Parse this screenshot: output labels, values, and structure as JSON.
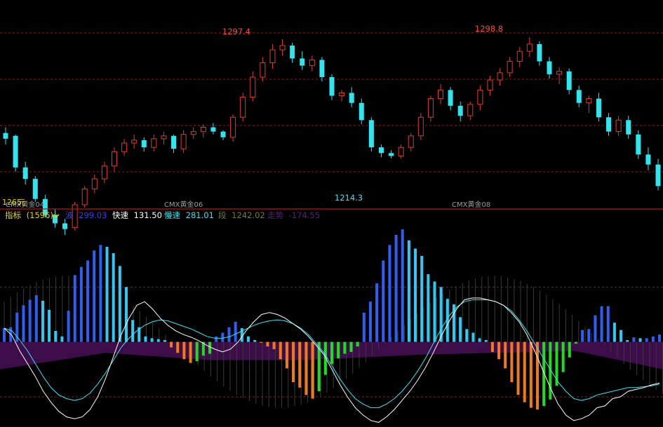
{
  "colors": {
    "background": "#000000",
    "grid": "#8b1a1a",
    "up": "#e23a2a",
    "down": "#2ee6f0",
    "high_label": "#ff4a3a",
    "low_label": "#35e5f2",
    "hist_blue": "#2f5ef5",
    "hist_cyan": "#30c9f5",
    "hist_orange": "#f07a1a",
    "hist_green": "#1fdc1f",
    "trend_fill": "#3d0d4a",
    "fast_line": "#ffffff",
    "slow_line": "#35e5f2",
    "contract_label": "#9a9a9a",
    "indicator_label": "#e8d400",
    "bo_value": "#3b3bff",
    "kuai_value": "#ffffff",
    "man_value": "#35e5f2",
    "duan_value": "#7a7a30",
    "zoushi_value": "#5a1e78"
  },
  "price_panel": {
    "high_label_1": "1297.4",
    "high_label_2": "1298.8",
    "low_label": "1214.3",
    "left_edge_label": "1265",
    "left_edge_unit": "元",
    "contract_labels": [
      "CMX黄金04",
      "CMX黄金06",
      "CMX黄金08"
    ]
  },
  "indicator_header": {
    "name": "指标",
    "param": "(1596)",
    "dropdown_icon": "chevron-down-icon",
    "items": [
      {
        "label": "波",
        "value": "299.03"
      },
      {
        "label": "快速",
        "value": "131.50"
      },
      {
        "label": "慢速",
        "value": "281.01"
      },
      {
        "label": "段",
        "value": "1242.02"
      },
      {
        "label": "走势",
        "value": "-174.55"
      }
    ]
  },
  "chart_data": [
    {
      "type": "candlestick",
      "title": "",
      "ylim": [
        1180,
        1315
      ],
      "candles": [
        [
          1232,
          1236,
          1224,
          1228
        ],
        [
          1230,
          1231,
          1205,
          1208
        ],
        [
          1208,
          1212,
          1196,
          1200
        ],
        [
          1200,
          1202,
          1184,
          1186
        ],
        [
          1186,
          1189,
          1173,
          1175
        ],
        [
          1175,
          1179,
          1166,
          1169
        ],
        [
          1169,
          1172,
          1161,
          1165
        ],
        [
          1166,
          1184,
          1164,
          1182
        ],
        [
          1182,
          1195,
          1180,
          1193
        ],
        [
          1193,
          1203,
          1190,
          1200
        ],
        [
          1200,
          1212,
          1197,
          1209
        ],
        [
          1209,
          1222,
          1205,
          1219
        ],
        [
          1219,
          1228,
          1216,
          1225
        ],
        [
          1225,
          1231,
          1221,
          1227
        ],
        [
          1227,
          1229,
          1219,
          1222
        ],
        [
          1222,
          1231,
          1219,
          1228
        ],
        [
          1228,
          1233,
          1224,
          1230
        ],
        [
          1230,
          1231,
          1218,
          1221
        ],
        [
          1221,
          1234,
          1218,
          1231
        ],
        [
          1231,
          1236,
          1228,
          1233
        ],
        [
          1233,
          1238,
          1229,
          1236
        ],
        [
          1236,
          1239,
          1231,
          1233
        ],
        [
          1233,
          1234,
          1227,
          1229
        ],
        [
          1229,
          1245,
          1226,
          1243
        ],
        [
          1243,
          1260,
          1240,
          1257
        ],
        [
          1257,
          1275,
          1254,
          1271
        ],
        [
          1271,
          1285,
          1268,
          1281
        ],
        [
          1281,
          1294,
          1277,
          1290
        ],
        [
          1290,
          1297.4,
          1286,
          1293
        ],
        [
          1293,
          1295,
          1281,
          1284
        ],
        [
          1284,
          1289,
          1276,
          1279
        ],
        [
          1279,
          1286,
          1275,
          1283
        ],
        [
          1283,
          1285,
          1268,
          1271
        ],
        [
          1271,
          1273,
          1255,
          1258
        ],
        [
          1258,
          1262,
          1254,
          1260
        ],
        [
          1260,
          1264,
          1250,
          1253
        ],
        [
          1253,
          1256,
          1238,
          1241
        ],
        [
          1241,
          1243,
          1219,
          1222
        ],
        [
          1222,
          1224,
          1215,
          1218
        ],
        [
          1218,
          1220,
          1214.3,
          1216
        ],
        [
          1216,
          1224,
          1214,
          1222
        ],
        [
          1222,
          1232,
          1219,
          1230
        ],
        [
          1230,
          1246,
          1227,
          1243
        ],
        [
          1243,
          1258,
          1240,
          1256
        ],
        [
          1256,
          1266,
          1252,
          1262
        ],
        [
          1262,
          1264,
          1248,
          1251
        ],
        [
          1251,
          1254,
          1240,
          1244
        ],
        [
          1244,
          1254,
          1241,
          1252
        ],
        [
          1252,
          1265,
          1248,
          1262
        ],
        [
          1262,
          1272,
          1258,
          1269
        ],
        [
          1269,
          1277,
          1265,
          1274
        ],
        [
          1274,
          1285,
          1271,
          1282
        ],
        [
          1282,
          1292,
          1278,
          1289
        ],
        [
          1289,
          1298.8,
          1285,
          1294
        ],
        [
          1294,
          1296,
          1279,
          1282
        ],
        [
          1282,
          1285,
          1270,
          1273
        ],
        [
          1273,
          1278,
          1266,
          1275
        ],
        [
          1275,
          1277,
          1259,
          1262
        ],
        [
          1262,
          1265,
          1250,
          1253
        ],
        [
          1253,
          1258,
          1246,
          1256
        ],
        [
          1256,
          1260,
          1240,
          1243
        ],
        [
          1243,
          1246,
          1230,
          1233
        ],
        [
          1233,
          1244,
          1230,
          1241
        ],
        [
          1241,
          1244,
          1228,
          1231
        ],
        [
          1231,
          1234,
          1214,
          1217
        ],
        [
          1217,
          1222,
          1206,
          1210
        ],
        [
          1210,
          1214,
          1192,
          1195
        ]
      ]
    },
    {
      "type": "bar",
      "title": "",
      "series": [
        {
          "name": "波",
          "values": [
            15,
            16,
            32,
            40,
            46,
            51,
            45,
            35,
            12,
            6,
            34,
            73,
            82,
            89,
            100,
            106,
            104,
            97,
            83,
            60,
            24,
            16,
            6,
            4,
            3,
            2,
            -6,
            -12,
            -19,
            -23,
            -21,
            -15,
            -13,
            6,
            10,
            16,
            22,
            15,
            6,
            2,
            -1,
            -5,
            -8,
            -19,
            -29,
            -44,
            -50,
            -58,
            -62,
            -54,
            -36,
            -24,
            -18,
            -13,
            -11,
            -5,
            32,
            44,
            64,
            89,
            106,
            117,
            123,
            111,
            102,
            94,
            74,
            66,
            60,
            47,
            41,
            27,
            14,
            10,
            4,
            2,
            -11,
            -19,
            -29,
            -44,
            -58,
            -66,
            -72,
            -74,
            -70,
            -63,
            -48,
            -33,
            -17,
            -2,
            13,
            14,
            29,
            39,
            39,
            21,
            13,
            2,
            5,
            4,
            4,
            6,
            8
          ]
        }
      ],
      "ylim": [
        -90,
        130
      ]
    },
    {
      "type": "line",
      "title": "",
      "series": [
        {
          "name": "快速",
          "values": [
            15,
            7,
            -10,
            -24,
            -38,
            -54,
            -66,
            -76,
            -82,
            -84,
            -82,
            -74,
            -60,
            -40,
            -16,
            8,
            26,
            40,
            44,
            36,
            26,
            18,
            12,
            8,
            5,
            1,
            -4,
            -8,
            -11,
            -8,
            0,
            12,
            22,
            30,
            32,
            30,
            26,
            20,
            14,
            6,
            -4,
            -14,
            -30,
            -46,
            -60,
            -72,
            -80,
            -86,
            -88,
            -82,
            -74,
            -64,
            -54,
            -42,
            -28,
            -12,
            6,
            22,
            36,
            46,
            48,
            48,
            46,
            44,
            40,
            32,
            22,
            8,
            -10,
            -30,
            -50,
            -68,
            -80,
            -86,
            -84,
            -80,
            -72,
            -70,
            -62,
            -60,
            -54,
            -52,
            -50,
            -47,
            -45
          ]
        },
        {
          "name": "慢速",
          "values": [
            15,
            12,
            2,
            -10,
            -24,
            -38,
            -50,
            -58,
            -62,
            -64,
            -62,
            -56,
            -46,
            -34,
            -20,
            -6,
            4,
            12,
            18,
            22,
            24,
            23,
            20,
            17,
            14,
            10,
            6,
            4,
            4,
            6,
            10,
            14,
            18,
            21,
            23,
            24,
            23,
            20,
            15,
            8,
            -2,
            -12,
            -26,
            -40,
            -52,
            -62,
            -68,
            -72,
            -72,
            -68,
            -62,
            -54,
            -44,
            -32,
            -18,
            -2,
            14,
            28,
            38,
            44,
            46,
            46,
            46,
            44,
            40,
            34,
            24,
            12,
            -2,
            -16,
            -30,
            -44,
            -54,
            -62,
            -64,
            -62,
            -58,
            -56,
            -54,
            -52,
            -50,
            -50,
            -49,
            -48,
            -46
          ]
        }
      ]
    }
  ]
}
